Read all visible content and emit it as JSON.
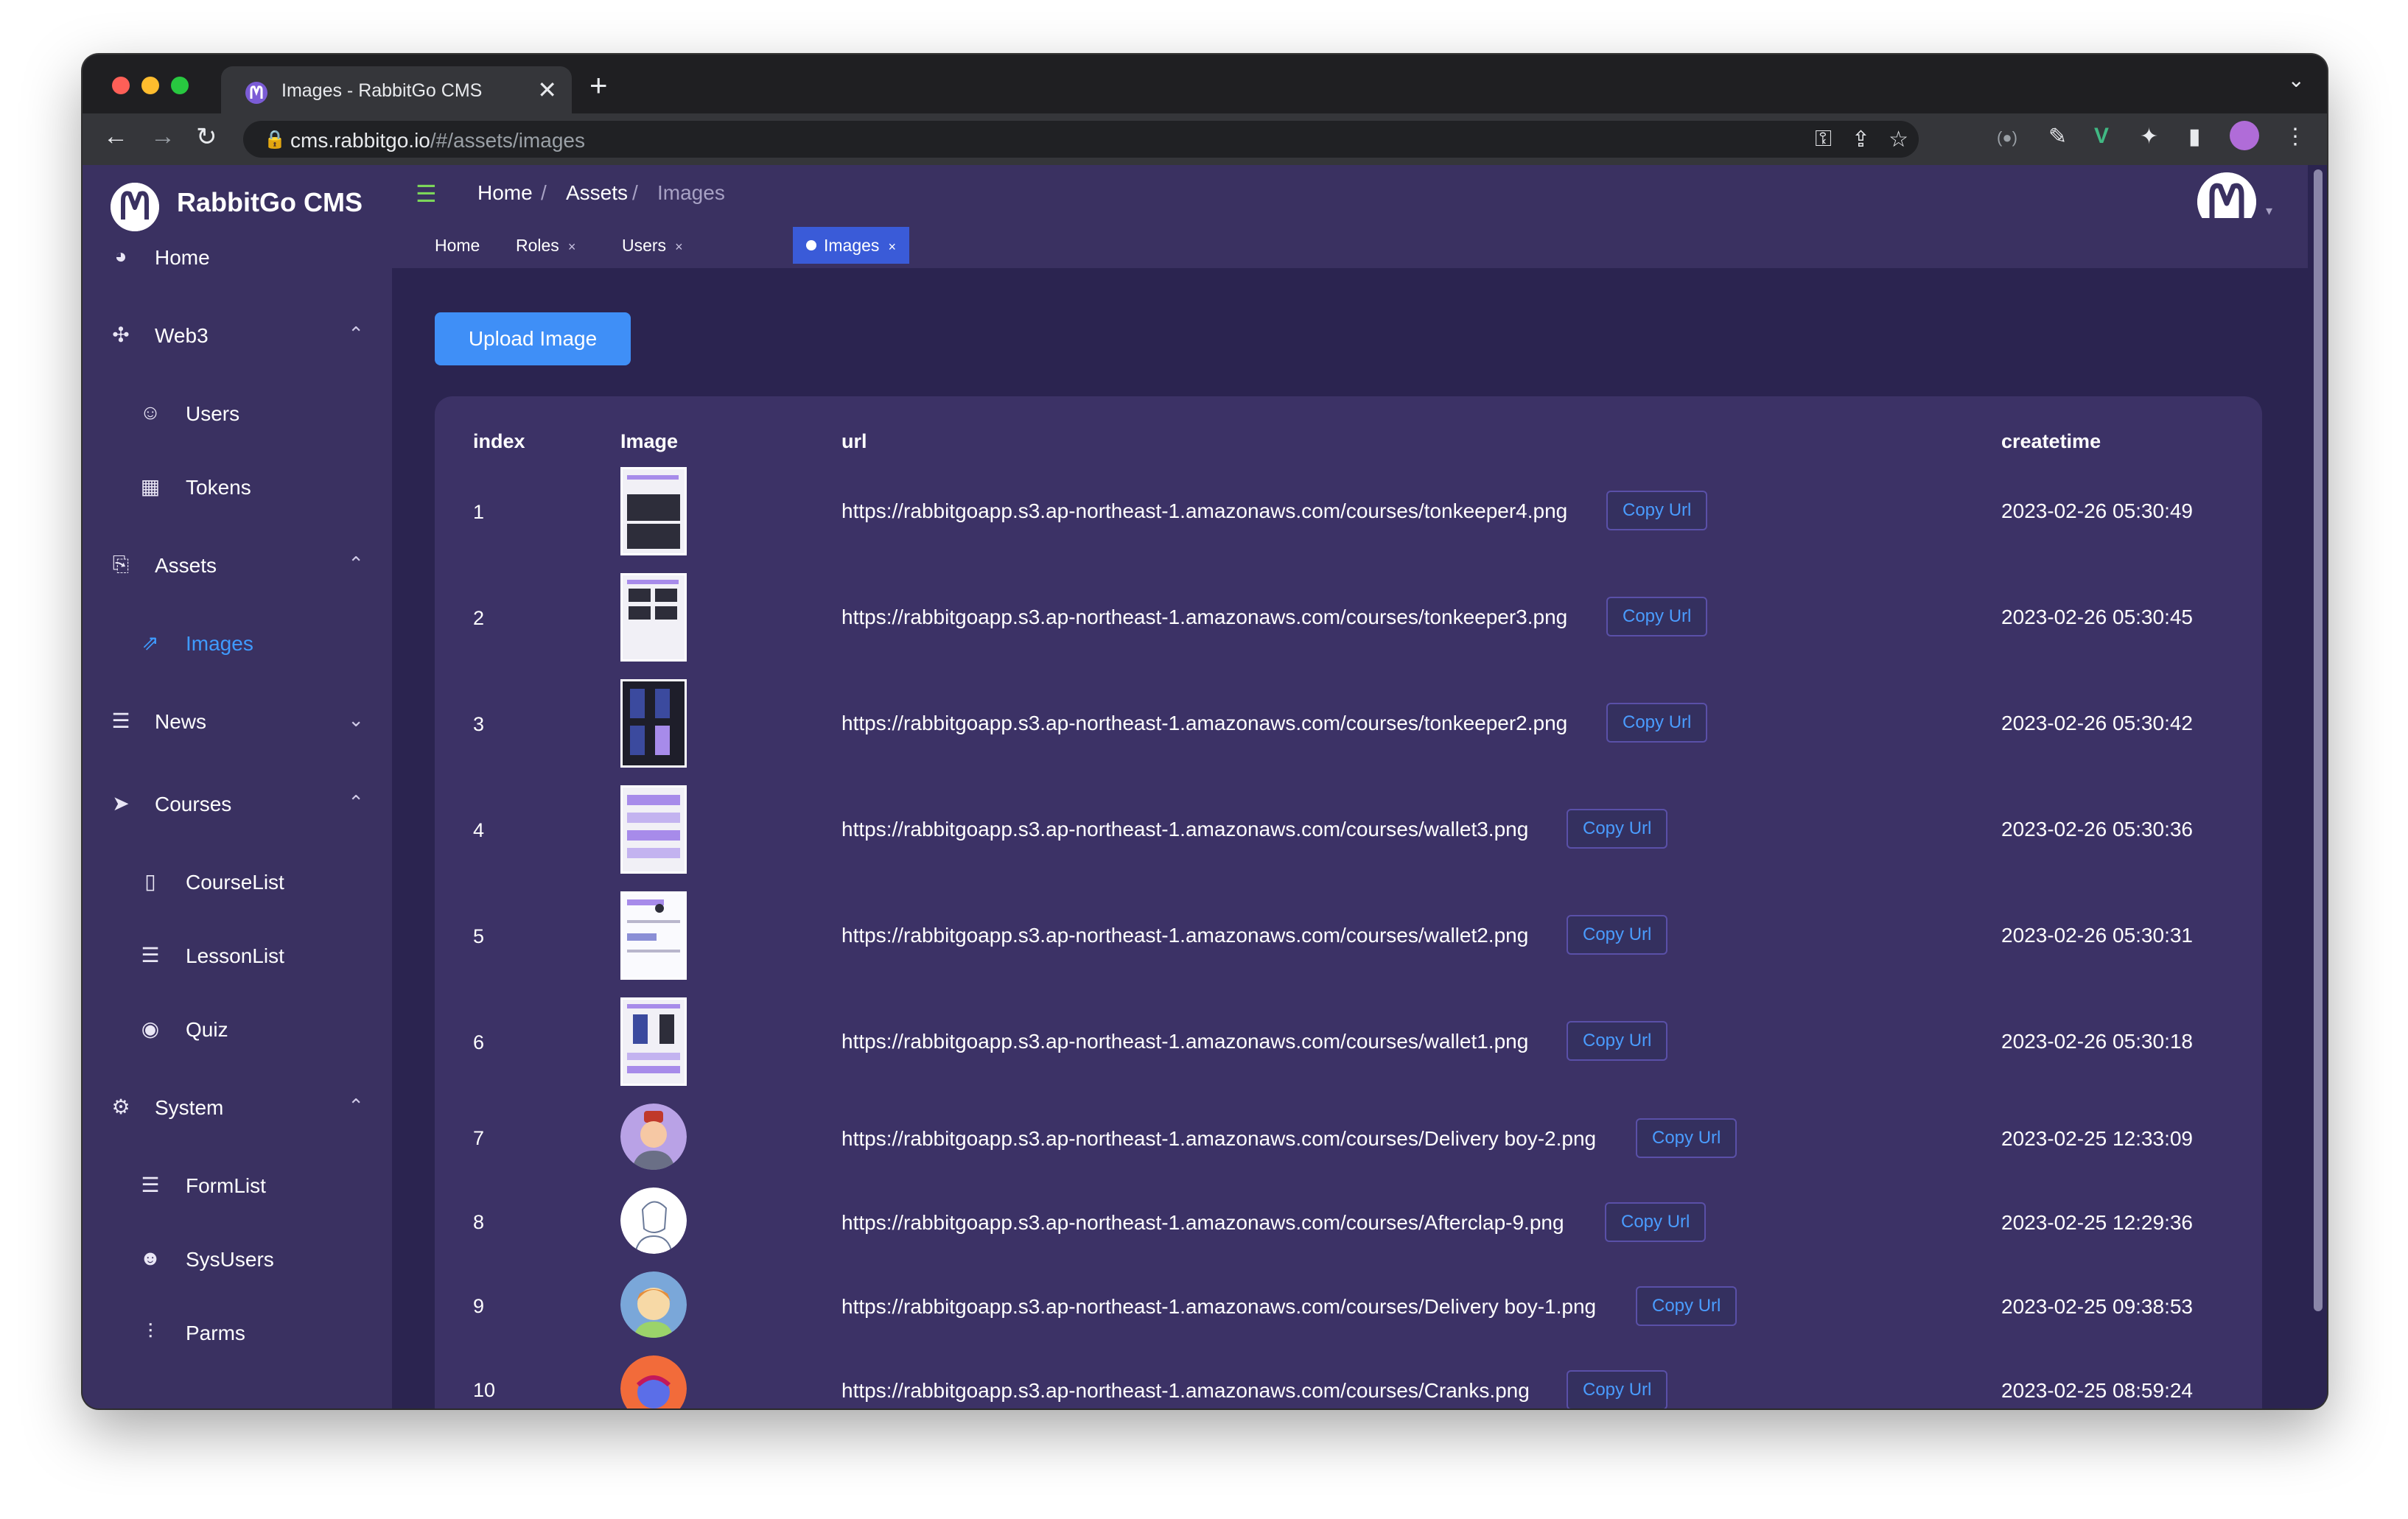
{
  "browser": {
    "tab_title": "Images - RabbitGo CMS",
    "tab_close": "✕",
    "new_tab": "+",
    "url_host": "cms.rabbitgo.io",
    "url_path": "/#/assets/images"
  },
  "sidebar": {
    "brand": "RabbitGo CMS",
    "items": [
      {
        "label": "Home",
        "icon": "dashboard-icon"
      },
      {
        "label": "Web3",
        "icon": "web3-icon",
        "expanded": true
      },
      {
        "label": "Users",
        "icon": "users-icon",
        "sub": true
      },
      {
        "label": "Tokens",
        "icon": "tokens-icon",
        "sub": true
      },
      {
        "label": "Assets",
        "icon": "assets-icon",
        "expanded": true
      },
      {
        "label": "Images",
        "icon": "external-link-icon",
        "sub": true,
        "active": true
      },
      {
        "label": "News",
        "icon": "list-icon",
        "expanded": false
      },
      {
        "label": "Courses",
        "icon": "send-icon",
        "expanded": true
      },
      {
        "label": "CourseList",
        "icon": "book-icon",
        "sub": true
      },
      {
        "label": "LessonList",
        "icon": "list-icon",
        "sub": true
      },
      {
        "label": "Quiz",
        "icon": "eye-icon",
        "sub": true
      },
      {
        "label": "System",
        "icon": "settings-icon",
        "expanded": true
      },
      {
        "label": "FormList",
        "icon": "list-icon",
        "sub": true
      },
      {
        "label": "SysUsers",
        "icon": "user-circle-icon",
        "sub": true
      },
      {
        "label": "Parms",
        "icon": "sliders-icon",
        "sub": true
      }
    ]
  },
  "header": {
    "breadcrumb": [
      "Home",
      "Assets",
      "Images"
    ],
    "separator": "/"
  },
  "tags": [
    {
      "label": "Home",
      "closable": false
    },
    {
      "label": "Roles",
      "closable": true
    },
    {
      "label": "Users",
      "closable": true
    },
    {
      "label": "Images",
      "closable": true,
      "active": true
    }
  ],
  "tag_close": "×",
  "main": {
    "upload_label": "Upload Image",
    "columns": [
      "index",
      "Image",
      "url",
      "createtime"
    ],
    "copy_label": "Copy Url",
    "rows": [
      {
        "index": "1",
        "url": "https://rabbitgoapp.s3.ap-northeast-1.amazonaws.com/courses/tonkeeper4.png",
        "createtime": "2023-02-26 05:30:49",
        "thumb": "dark-screens"
      },
      {
        "index": "2",
        "url": "https://rabbitgoapp.s3.ap-northeast-1.amazonaws.com/courses/tonkeeper3.png",
        "createtime": "2023-02-26 05:30:45",
        "thumb": "mixed-screens"
      },
      {
        "index": "3",
        "url": "https://rabbitgoapp.s3.ap-northeast-1.amazonaws.com/courses/tonkeeper2.png",
        "createtime": "2023-02-26 05:30:42",
        "thumb": "dark-grid"
      },
      {
        "index": "4",
        "url": "https://rabbitgoapp.s3.ap-northeast-1.amazonaws.com/courses/wallet3.png",
        "createtime": "2023-02-26 05:30:36",
        "thumb": "lavender-doc"
      },
      {
        "index": "5",
        "url": "https://rabbitgoapp.s3.ap-northeast-1.amazonaws.com/courses/wallet2.png",
        "createtime": "2023-02-26 05:30:31",
        "thumb": "white-doc"
      },
      {
        "index": "6",
        "url": "https://rabbitgoapp.s3.ap-northeast-1.amazonaws.com/courses/wallet1.png",
        "createtime": "2023-02-26 05:30:18",
        "thumb": "phone-doc"
      },
      {
        "index": "7",
        "url": "https://rabbitgoapp.s3.ap-northeast-1.amazonaws.com/courses/Delivery boy-2.png",
        "createtime": "2023-02-25 12:33:09",
        "thumb": "avatar-purple"
      },
      {
        "index": "8",
        "url": "https://rabbitgoapp.s3.ap-northeast-1.amazonaws.com/courses/Afterclap-9.png",
        "createtime": "2023-02-25 12:29:36",
        "thumb": "avatar-white"
      },
      {
        "index": "9",
        "url": "https://rabbitgoapp.s3.ap-northeast-1.amazonaws.com/courses/Delivery boy-1.png",
        "createtime": "2023-02-25 09:38:53",
        "thumb": "avatar-blue"
      },
      {
        "index": "10",
        "url": "https://rabbitgoapp.s3.ap-northeast-1.amazonaws.com/courses/Cranks.png",
        "createtime": "2023-02-25 08:59:24",
        "thumb": "avatar-orange"
      }
    ]
  },
  "colors": {
    "accent": "#3f8ff7",
    "sidebar_bg": "#3a3161",
    "content_bg": "#2b2450",
    "card_bg": "#3c3266",
    "active_link": "#3f9bff"
  }
}
